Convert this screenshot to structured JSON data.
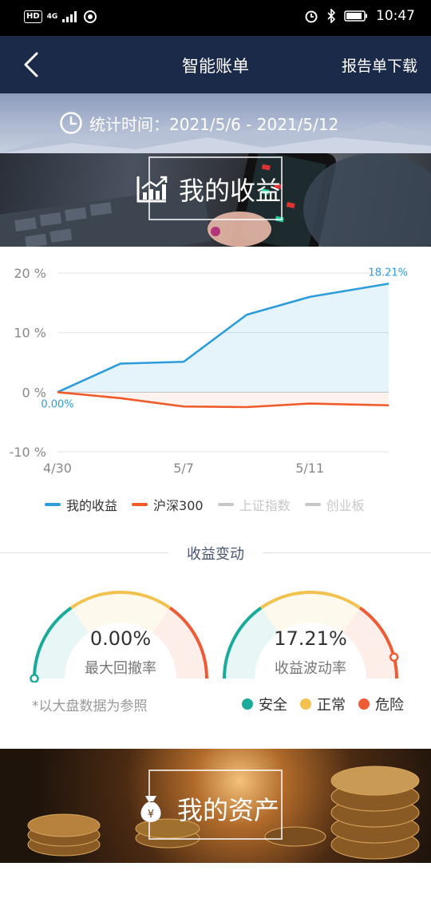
{
  "status_bar": {
    "network_badge": "HD",
    "network_type": "4G",
    "time": "10:47"
  },
  "nav": {
    "title": "智能账单",
    "download_label": "报告单下载"
  },
  "period": {
    "label": "统计时间：2021/5/6 - 2021/5/12"
  },
  "income_banner": {
    "title": "我的收益"
  },
  "assets_banner": {
    "title": "我的资产"
  },
  "chart_data": {
    "type": "area",
    "y_tick_labels": [
      "20 %",
      "10 %",
      "0 %",
      "-10 %"
    ],
    "y_ticks": [
      20,
      10,
      0,
      -10
    ],
    "ylim": [
      -10,
      20
    ],
    "x_tick_labels": [
      "4/30",
      "5/7",
      "5/11"
    ],
    "x_tick_positions": [
      0,
      4,
      8
    ],
    "xlim": [
      0,
      10.5
    ],
    "series": [
      {
        "name": "我的收益",
        "color": "#2d9cdb",
        "x": [
          0,
          2,
          4,
          6,
          8,
          10.5
        ],
        "values": [
          0.0,
          4.8,
          5.1,
          13.0,
          16.0,
          18.21
        ],
        "start_label": "0.00%",
        "end_label": "18.21%"
      },
      {
        "name": "沪深300",
        "color": "#f05a28",
        "x": [
          0,
          2,
          4,
          6,
          8,
          10.5
        ],
        "values": [
          0.0,
          -1.0,
          -2.4,
          -2.5,
          -1.9,
          -2.2
        ]
      }
    ],
    "legend": [
      {
        "name": "我的收益",
        "color": "#2d9cdb",
        "active": true
      },
      {
        "name": "沪深300",
        "color": "#f05a28",
        "active": true
      },
      {
        "name": "上证指数",
        "color": "#c8c8c8",
        "active": false
      },
      {
        "name": "创业板",
        "color": "#c8c8c8",
        "active": false
      }
    ]
  },
  "change_section": {
    "title": "收益变动"
  },
  "gauges": [
    {
      "value": "0.00%",
      "caption": "最大回撤率",
      "fraction": 0.0
    },
    {
      "value": "17.21%",
      "caption": "收益波动率",
      "fraction": 0.92
    }
  ],
  "note": "*以大盘数据为参照",
  "risk_legend": [
    {
      "label": "安全",
      "color": "#1aab9b"
    },
    {
      "label": "正常",
      "color": "#f2c14e"
    },
    {
      "label": "危险",
      "color": "#ef5b35"
    }
  ]
}
